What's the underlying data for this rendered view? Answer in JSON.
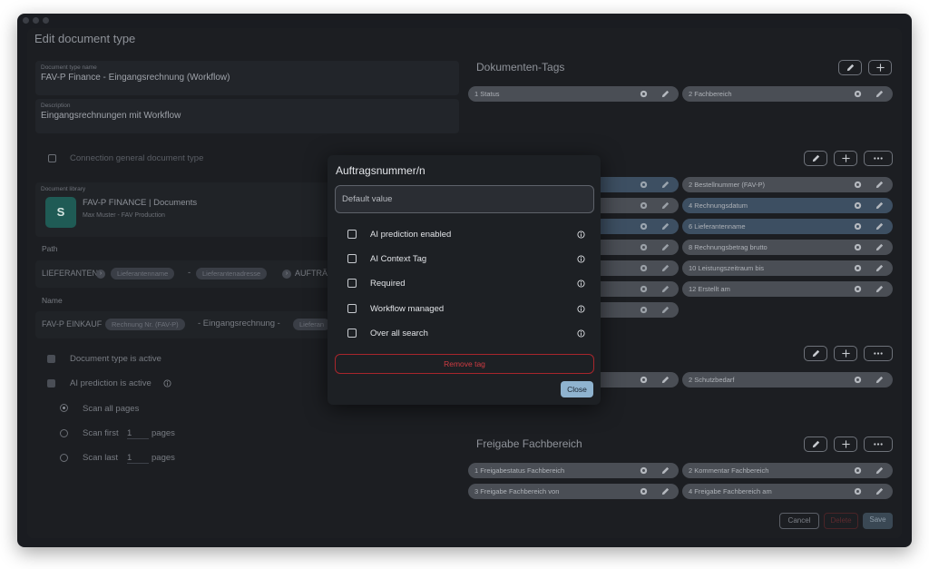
{
  "window": {
    "title": "Edit document type"
  },
  "left": {
    "name_field": {
      "label": "Document type name",
      "value": "FAV-P Finance - Eingangsrechnung (Workflow)"
    },
    "description_field": {
      "label": "Description",
      "value": "Eingangsrechnungen mit Workflow"
    },
    "connection_general": "Connection general document type",
    "library": {
      "label": "Document library",
      "name": "FAV-P FINANCE | Documents",
      "owner": "Max Muster - FAV Production",
      "icon": "sharepoint-icon",
      "icon_letter": "S"
    },
    "path": {
      "label": "Path",
      "root": "LIEFERANTEN",
      "tag1": "Lieferantenname",
      "sep": "-",
      "tag2": "Lieferantenadresse",
      "after": "AUFTRÄG"
    },
    "name": {
      "label": "Name",
      "prefix": "FAV-P EINKAUF",
      "tag1": "Rechnung Nr. (FAV-P)",
      "middle": "- Eingangsrechnung -",
      "tag2": "Lieferan"
    },
    "active_label": "Document type is active",
    "ai_active_label": "AI prediction is active",
    "scan_all": "Scan all pages",
    "scan_first": "Scan first",
    "scan_last": "Scan last",
    "pages_value": "1",
    "pages_label": "pages"
  },
  "right": {
    "section1": {
      "title": "Dokumenten-Tags",
      "tags": [
        "1 Status",
        "2 Fachbereich"
      ]
    },
    "section2": {
      "right_col": [
        "2 Bestellnummer (FAV-P)",
        "4 Rechnungsdatum",
        "6 Lieferantenname",
        "8 Rechnungsbetrag brutto",
        "10 Leistungszeitraum bis",
        "12 Erstellt am"
      ]
    },
    "section3": {
      "tag": "2 Schutzbedarf"
    },
    "section4": {
      "title": "Freigabe Fachbereich",
      "tags": [
        "1 Freigabestatus Fachbereich",
        "2 Kommentar Fachbereich",
        "3 Freigabe Fachbereich von",
        "4 Freigabe Fachbereich am"
      ]
    }
  },
  "footer": {
    "cancel": "Cancel",
    "delete": "Delete",
    "save": "Save"
  },
  "modal": {
    "title": "Auftragsnummer/n",
    "default_value_placeholder": "Default value",
    "options": [
      "AI prediction enabled",
      "AI Context Tag",
      "Required",
      "Workflow managed",
      "Over all search"
    ],
    "remove": "Remove tag",
    "close": "Close"
  },
  "colors": {
    "accent": "#8fb3cf",
    "danger": "#cf3b42",
    "background": "#1a1c21"
  }
}
